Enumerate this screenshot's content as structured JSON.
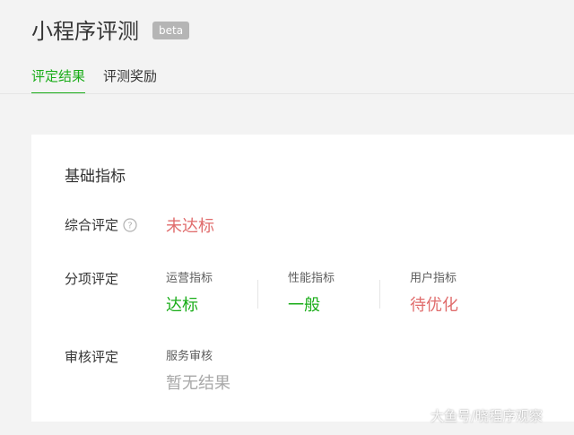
{
  "header": {
    "title": "小程序评测",
    "badge": "beta"
  },
  "tabs": [
    {
      "label": "评定结果",
      "active": true
    },
    {
      "label": "评测奖励",
      "active": false
    }
  ],
  "basic_metrics": {
    "section_title": "基础指标",
    "overall": {
      "label": "综合评定",
      "help_icon": "question-circle-icon",
      "value": "未达标"
    },
    "itemized": {
      "label": "分项评定",
      "items": [
        {
          "label": "运营指标",
          "value": "达标"
        },
        {
          "label": "性能指标",
          "value": "一般"
        },
        {
          "label": "用户指标",
          "value": "待优化"
        }
      ]
    },
    "review": {
      "label": "审核评定",
      "item_label": "服务审核",
      "value": "暂无结果"
    }
  },
  "watermark": "大鱼号/晓程序观察",
  "colors": {
    "accent_green": "#1aad19",
    "warning_red": "#e06c6c",
    "muted_gray": "#a8a8a8",
    "badge_gray": "#b5b5b5"
  }
}
